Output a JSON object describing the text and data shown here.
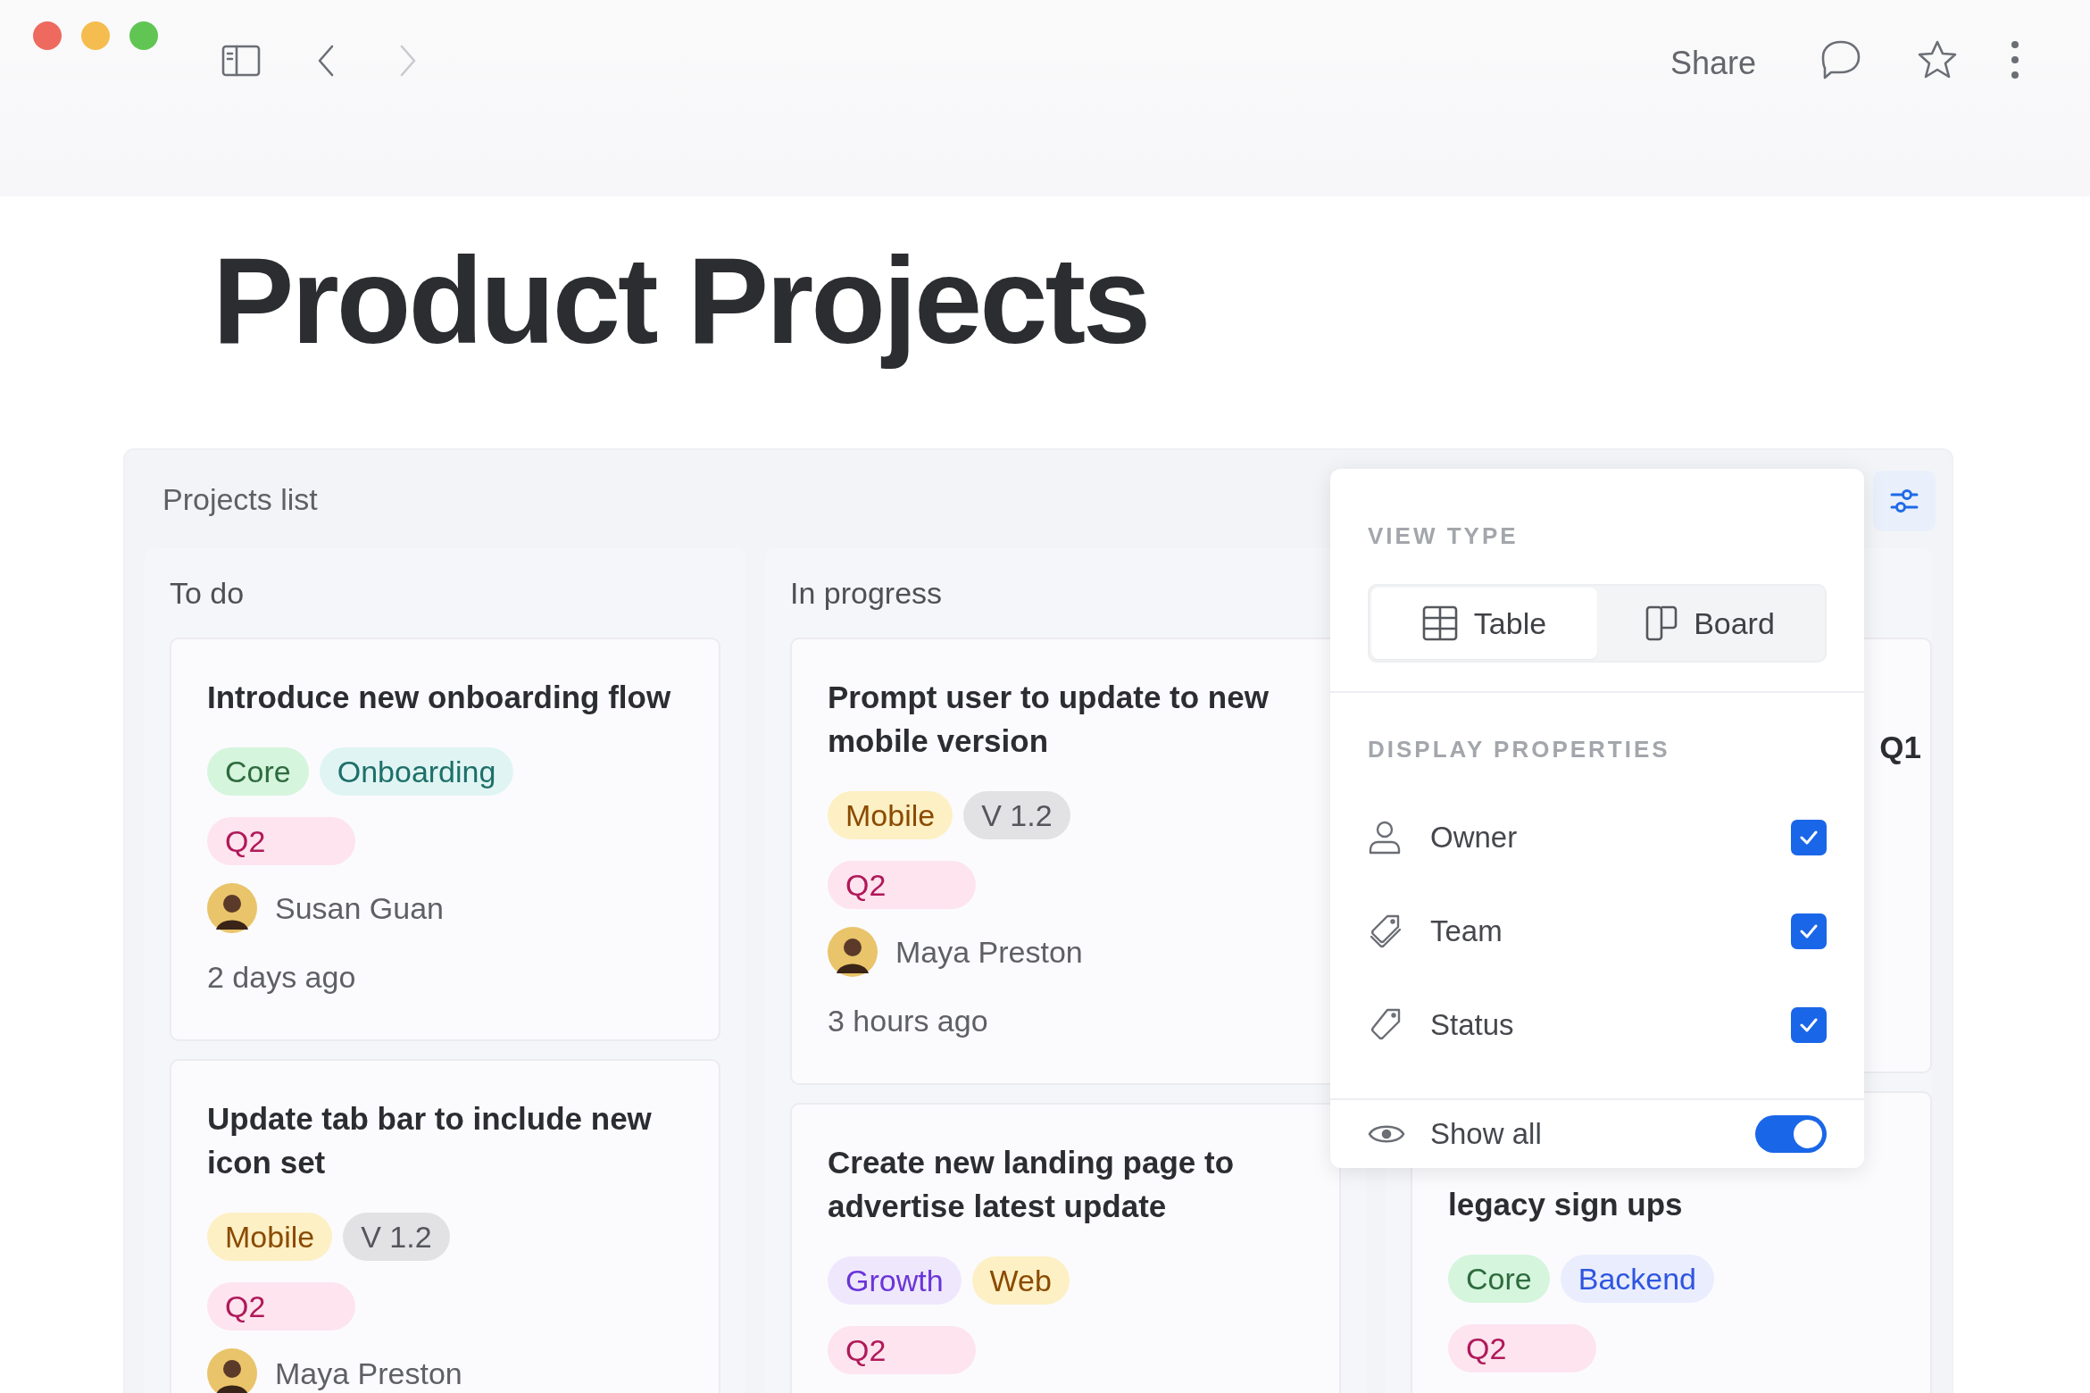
{
  "toolbar": {
    "share": "Share"
  },
  "title": "Product Projects",
  "board": {
    "name": "Projects list",
    "columns": [
      {
        "header": "To do",
        "cards": [
          {
            "title": "Introduce new onboarding flow",
            "tags": [
              {
                "label": "Core",
                "color": "#d5f5dd"
              },
              {
                "label": "Onboarding",
                "color": "#e0f5f3"
              }
            ],
            "status": {
              "label": "Q2",
              "color": "#fde4ee"
            },
            "owner": "Susan Guan",
            "time": "2 days ago"
          },
          {
            "title": "Update tab bar to include new icon set",
            "tags": [
              {
                "label": "Mobile",
                "color": "#fdf0c4"
              },
              {
                "label": "V 1.2",
                "color": "#e2e2e5"
              }
            ],
            "status": {
              "label": "Q2",
              "color": "#fde4ee"
            },
            "owner": "Maya Preston"
          }
        ]
      },
      {
        "header": "In progress",
        "cards": [
          {
            "title": "Prompt user to update to new mobile version",
            "tags": [
              {
                "label": "Mobile",
                "color": "#fdf0c4"
              },
              {
                "label": "V 1.2",
                "color": "#e2e2e5"
              }
            ],
            "status": {
              "label": "Q2",
              "color": "#fde4ee"
            },
            "owner": "Maya Preston",
            "time": "3 hours ago"
          },
          {
            "title": "Create new landing page to advertise latest update",
            "tags": [
              {
                "label": "Growth",
                "color": "#efe8fd"
              },
              {
                "label": "Web",
                "color": "#fdf0c4"
              }
            ],
            "status": {
              "label": "Q2",
              "color": "#fde4ee"
            }
          }
        ]
      },
      {
        "cards": [
          {
            "title": "Q1"
          },
          {
            "title": "legacy sign ups",
            "tags": [
              {
                "label": "Core",
                "color": "#d5f5dd"
              },
              {
                "label": "Backend",
                "color": "#e9edfd"
              }
            ],
            "status": {
              "label": "Q2",
              "color": "#fde4ee"
            }
          }
        ]
      }
    ]
  },
  "popover": {
    "view_type_label": "VIEW TYPE",
    "view_types": [
      {
        "kind": "table",
        "label": "Table",
        "selected": true
      },
      {
        "kind": "board",
        "label": "Board",
        "selected": false
      }
    ],
    "properties_label": "DISPLAY PROPERTIES",
    "properties": [
      {
        "kind": "person",
        "label": "Owner",
        "checked": true
      },
      {
        "kind": "tags",
        "label": "Team",
        "checked": true
      },
      {
        "kind": "tag",
        "label": "Status",
        "checked": true
      }
    ],
    "show_all": {
      "label": "Show all",
      "on": true
    }
  }
}
